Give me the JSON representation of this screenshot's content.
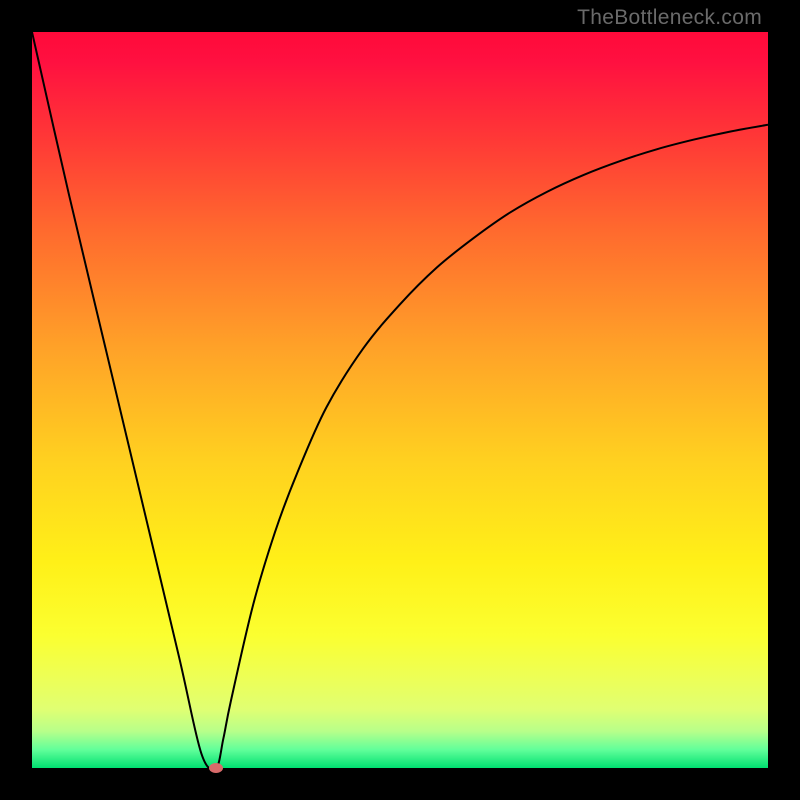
{
  "watermark": "TheBottleneck.com",
  "chart_data": {
    "type": "line",
    "title": "",
    "xlabel": "",
    "ylabel": "",
    "xlim": [
      0,
      100
    ],
    "ylim": [
      0,
      100
    ],
    "grid": false,
    "series": [
      {
        "name": "curve",
        "x": [
          0,
          5,
          10,
          15,
          20,
          23,
          25,
          26,
          27,
          30,
          33,
          36,
          40,
          45,
          50,
          55,
          60,
          65,
          70,
          75,
          80,
          85,
          90,
          95,
          100
        ],
        "values": [
          100,
          78,
          57,
          36,
          15,
          2,
          0,
          4,
          9,
          22,
          32,
          40,
          49,
          57,
          63,
          68,
          72,
          75.5,
          78.3,
          80.6,
          82.5,
          84.1,
          85.4,
          86.5,
          87.4
        ]
      }
    ],
    "marker": {
      "x": 25,
      "y": 0,
      "color": "#d86a6a"
    }
  },
  "colors": {
    "curve": "#000000",
    "marker": "#d86a6a",
    "frame": "#000000"
  }
}
